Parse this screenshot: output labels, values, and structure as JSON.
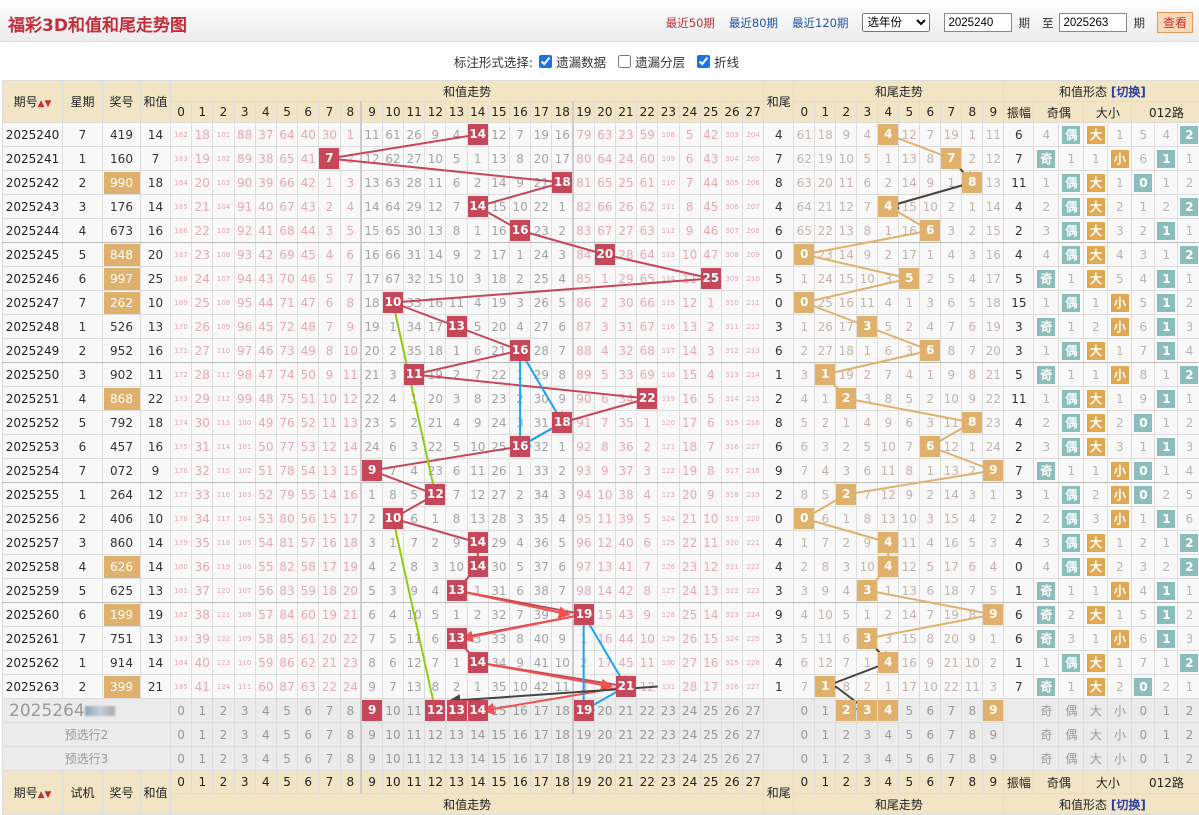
{
  "header": {
    "title": "福彩3D和值和尾走势图",
    "links": [
      {
        "label": "最近50期",
        "active": true
      },
      {
        "label": "最近80期"
      },
      {
        "label": "最近120期"
      }
    ],
    "year_select": "选年份",
    "from": "2025240",
    "period_label": "期",
    "to_label": "至",
    "to": "2025263",
    "view_button": "查看"
  },
  "options": {
    "label": "标注形式选择:",
    "items": [
      {
        "label": "遗漏数据",
        "checked": true
      },
      {
        "label": "遗漏分层",
        "checked": false
      },
      {
        "label": "折线",
        "checked": true
      }
    ]
  },
  "columns": {
    "period": "期号",
    "weekday": "星期",
    "number": "奖号",
    "sum": "和值",
    "sum_trend": "和值走势",
    "tail": "和尾",
    "tail_trend": "和尾走势",
    "form": "和值形态",
    "switch": "[切换]",
    "amplitude": "振幅",
    "odd_even": "奇偶",
    "big_small": "大小",
    "route": "012路",
    "test": "试机",
    "odd": "奇",
    "even": "偶",
    "big": "大",
    "small": "小"
  },
  "colors": {
    "sum_ball": "#c64759",
    "tail_ball": "#e0b16c",
    "pair_highlight": "#e0b16c",
    "teal": "#8bbdbd"
  },
  "baseline": {
    "sum_miss": [
      162,
      18,
      101,
      88,
      37,
      64,
      40,
      30,
      1,
      11,
      61,
      26,
      9,
      4,
      0,
      12,
      7,
      19,
      16,
      79,
      63,
      23,
      59,
      108,
      5,
      42,
      303,
      204
    ],
    "tail_miss": [
      61,
      18,
      9,
      4,
      0,
      12,
      7,
      19,
      1,
      11
    ],
    "odd_miss": 4,
    "even_miss": 0,
    "big_miss": 0,
    "small_miss": 1,
    "route_miss": [
      5,
      4,
      0
    ],
    "first_amplitude": 6
  },
  "rows": [
    {
      "period": "2025240",
      "weekday": "7",
      "number": "419",
      "sum": 14
    },
    {
      "period": "2025241",
      "weekday": "1",
      "number": "160",
      "sum": 7
    },
    {
      "period": "2025242",
      "weekday": "2",
      "number": "990",
      "sum": 18,
      "pair": true
    },
    {
      "period": "2025243",
      "weekday": "3",
      "number": "176",
      "sum": 14
    },
    {
      "period": "2025244",
      "weekday": "4",
      "number": "673",
      "sum": 16
    },
    {
      "period": "2025245",
      "weekday": "5",
      "number": "848",
      "sum": 20,
      "pair": true
    },
    {
      "period": "2025246",
      "weekday": "6",
      "number": "997",
      "sum": 25,
      "pair": true
    },
    {
      "period": "2025247",
      "weekday": "7",
      "number": "262",
      "sum": 10,
      "pair": true
    },
    {
      "period": "2025248",
      "weekday": "1",
      "number": "526",
      "sum": 13
    },
    {
      "period": "2025249",
      "weekday": "2",
      "number": "952",
      "sum": 16
    },
    {
      "period": "2025250",
      "weekday": "3",
      "number": "902",
      "sum": 11
    },
    {
      "period": "2025251",
      "weekday": "4",
      "number": "868",
      "sum": 22,
      "pair": true
    },
    {
      "period": "2025252",
      "weekday": "5",
      "number": "792",
      "sum": 18
    },
    {
      "period": "2025253",
      "weekday": "6",
      "number": "457",
      "sum": 16
    },
    {
      "period": "2025254",
      "weekday": "7",
      "number": "072",
      "sum": 9
    },
    {
      "period": "2025255",
      "weekday": "1",
      "number": "264",
      "sum": 12
    },
    {
      "period": "2025256",
      "weekday": "2",
      "number": "406",
      "sum": 10
    },
    {
      "period": "2025257",
      "weekday": "3",
      "number": "860",
      "sum": 14
    },
    {
      "period": "2025258",
      "weekday": "4",
      "number": "626",
      "sum": 14,
      "pair": true
    },
    {
      "period": "2025259",
      "weekday": "5",
      "number": "625",
      "sum": 13
    },
    {
      "period": "2025260",
      "weekday": "6",
      "number": "199",
      "sum": 19,
      "pair": true
    },
    {
      "period": "2025261",
      "weekday": "7",
      "number": "751",
      "sum": 13
    },
    {
      "period": "2025262",
      "weekday": "1",
      "number": "914",
      "sum": 14
    },
    {
      "period": "2025263",
      "weekday": "2",
      "number": "399",
      "sum": 21,
      "pair": true
    }
  ],
  "forecast": {
    "period": "2025264",
    "rows": [
      {
        "label": "",
        "sum_picks": [
          9,
          12,
          13,
          14,
          19
        ],
        "tail_picks": [
          2,
          3,
          4,
          9
        ]
      },
      {
        "label": "预选行2",
        "sum_picks": [],
        "tail_picks": []
      },
      {
        "label": "预选行3",
        "sum_picks": [],
        "tail_picks": []
      }
    ]
  },
  "arrows": [
    {
      "from": [
        7,
        10
      ],
      "to": [
        15,
        12
      ],
      "color": "#8fcc10",
      "area": "sum"
    },
    {
      "from": [
        16,
        10
      ],
      "to": [
        24,
        12
      ],
      "color": "#8fcc10",
      "area": "sum"
    },
    {
      "from": [
        9,
        16
      ],
      "to": [
        13,
        16
      ],
      "color": "#1aa3f0",
      "area": "sum"
    },
    {
      "from": [
        9,
        16
      ],
      "to": [
        12,
        18
      ],
      "color": "#1aa3f0",
      "area": "sum"
    },
    {
      "from": [
        12,
        18
      ],
      "to": [
        13,
        16
      ],
      "color": "#1aa3f0",
      "area": "sum"
    },
    {
      "from": [
        19,
        13
      ],
      "to": [
        20,
        18.3
      ],
      "color": "#f05050",
      "area": "sum"
    },
    {
      "from": [
        20,
        19
      ],
      "to": [
        21,
        13.3
      ],
      "color": "#f05050",
      "area": "sum"
    },
    {
      "from": [
        22,
        14
      ],
      "to": [
        23,
        20.3
      ],
      "color": "#f05050",
      "area": "sum"
    },
    {
      "from": [
        23,
        21
      ],
      "to": [
        24,
        14.3
      ],
      "color": "#f05050",
      "area": "sum"
    },
    {
      "from": [
        20,
        19
      ],
      "to": [
        24,
        19
      ],
      "color": "#1aa3f0",
      "area": "sum"
    },
    {
      "from": [
        20,
        19
      ],
      "to": [
        23,
        21
      ],
      "color": "#1aa3f0",
      "area": "sum"
    },
    {
      "from": [
        23,
        21
      ],
      "to": [
        24,
        19
      ],
      "color": "#1aa3f0",
      "area": "sum"
    },
    {
      "from": [
        23,
        22.5
      ],
      "to": [
        23.6,
        12.7
      ],
      "color": "#444",
      "area": "sum"
    },
    {
      "from": [
        1,
        7
      ],
      "to": [
        2,
        8
      ],
      "color": "#444",
      "area": "tail"
    },
    {
      "from": [
        2,
        8
      ],
      "to": [
        3,
        4
      ],
      "color": "#444",
      "area": "tail"
    },
    {
      "from": [
        21,
        3
      ],
      "to": [
        22,
        4
      ],
      "color": "#444",
      "area": "tail"
    },
    {
      "from": [
        22,
        4
      ],
      "to": [
        23,
        1
      ],
      "color": "#444",
      "area": "tail"
    },
    {
      "from": [
        23,
        1.5
      ],
      "to": [
        24,
        3
      ],
      "color": "#444",
      "area": "tail"
    }
  ]
}
